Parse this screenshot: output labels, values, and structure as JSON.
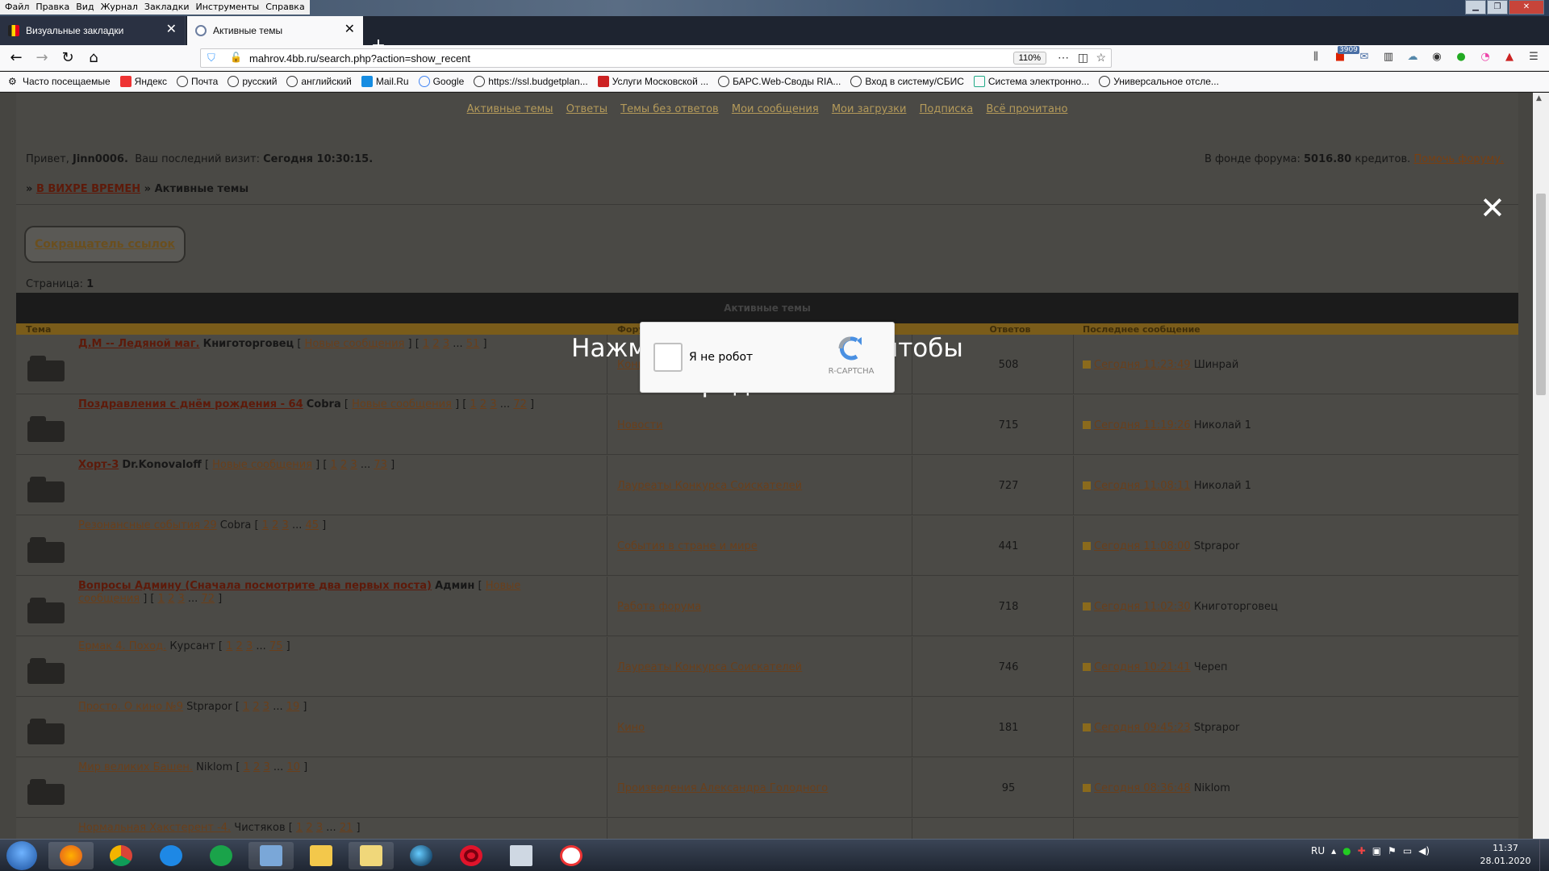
{
  "menubar": [
    "Файл",
    "Правка",
    "Вид",
    "Журнал",
    "Закладки",
    "Инструменты",
    "Справка"
  ],
  "tabs": [
    {
      "label": "Визуальные закладки"
    },
    {
      "label": "Активные темы"
    }
  ],
  "urlbar": {
    "url": "mahrov.4bb.ru/search.php?action=show_recent",
    "zoom": "110%"
  },
  "toolbar_badge": "3909",
  "bookmarks": [
    "Часто посещаемые",
    "Яндекс",
    "Почта",
    "русский",
    "английский",
    "Mail.Ru",
    "Google",
    "https://ssl.budgetplan...",
    "Услуги Московской ...",
    "БАРС.Web-Своды RIA...",
    "Вход в систему/СБИС",
    "Система электронно...",
    "Универсальное отсле..."
  ],
  "forum": {
    "nav_links": [
      "Активные темы",
      "Ответы",
      "Темы без ответов",
      "Мои сообщения",
      "Мои загрузки",
      "Подписка",
      "Всё прочитано"
    ],
    "greeting_prefix": "Привет,",
    "username": "Jinn0006.",
    "last_visit_label": "Ваш последний визит:",
    "last_visit": "Сегодня 10:30:15.",
    "fund_label": "В фонде форума:",
    "fund_amount": "5016.80",
    "fund_unit": "кредитов.",
    "fund_link": "Помочь форуму.",
    "breadcrumb_root": "В ВИХРЕ ВРЕМЕН",
    "breadcrumb_current": "Активные темы",
    "shortener_btn": "Сокращатель ссылок",
    "page_label": "Страница:",
    "page_num": "1",
    "table_title": "Активные темы",
    "columns": {
      "topic": "Тема",
      "forum": "Форум",
      "replies": "Ответов",
      "last": "Последнее сообщение"
    },
    "rows": [
      {
        "title": "Д.М -- Ледяной маг.",
        "author": "Книготорговец",
        "new": "Новые сообщения",
        "pages": [
          "1",
          "2",
          "3",
          "...",
          "51"
        ],
        "forum": "Конкурс Соискателей",
        "replies": "508",
        "last_time": "Сегодня 11:23:49",
        "last_author": "Шинрай",
        "bold": true
      },
      {
        "title": "Поздравления с днём рождения - 64",
        "author": "Cobra",
        "new": "Новые сообщения",
        "pages": [
          "1",
          "2",
          "3",
          "...",
          "72"
        ],
        "forum": "Новости",
        "replies": "715",
        "last_time": "Сегодня 11:19:26",
        "last_author": "Николай 1",
        "bold": true
      },
      {
        "title": "Хорт-3",
        "author": "Dr.Konovaloff",
        "new": "Новые сообщения",
        "pages": [
          "1",
          "2",
          "3",
          "...",
          "73"
        ],
        "forum": "Лауреаты Конкурса Соискателей",
        "replies": "727",
        "last_time": "Сегодня 11:08:11",
        "last_author": "Николай 1",
        "bold": true
      },
      {
        "title": "Резонансные события 29",
        "author": "Cobra",
        "new": "",
        "pages": [
          "1",
          "2",
          "3",
          "...",
          "45"
        ],
        "forum": "События в стране и мире",
        "replies": "441",
        "last_time": "Сегодня 11:08:00",
        "last_author": "Stprapor",
        "bold": false
      },
      {
        "title": "Вопросы Админу (Сначала посмотрите два первых поста)",
        "author": "Админ",
        "new": "Новые сообщения",
        "pages": [
          "1",
          "2",
          "3",
          "...",
          "72"
        ],
        "forum": "Работа форума",
        "replies": "718",
        "last_time": "Сегодня 11:02:30",
        "last_author": "Книготорговец",
        "bold": true
      },
      {
        "title": "Ермак 4. Поход.",
        "author": "Курсант",
        "new": "",
        "pages": [
          "1",
          "2",
          "3",
          "...",
          "75"
        ],
        "forum": "Лауреаты Конкурса Соискателей",
        "replies": "746",
        "last_time": "Сегодня 10:21:41",
        "last_author": "Череп",
        "bold": false
      },
      {
        "title": "Просто. О кино №9",
        "author": "Stprapor",
        "new": "",
        "pages": [
          "1",
          "2",
          "3",
          "...",
          "19"
        ],
        "forum": "Кино",
        "replies": "181",
        "last_time": "Сегодня 09:45:23",
        "last_author": "Stprapor",
        "bold": false
      },
      {
        "title": "Мир великих Башен.",
        "author": "Niklom",
        "new": "",
        "pages": [
          "1",
          "2",
          "3",
          "...",
          "10"
        ],
        "forum": "Произведения Александра Голодного",
        "replies": "95",
        "last_time": "Сегодня 08:36:48",
        "last_author": "Niklom",
        "bold": false
      },
      {
        "title": "Нормальная Хакстерент -4.",
        "author": "Чистяков",
        "new": "",
        "pages": [
          "1",
          "2",
          "3",
          "...",
          "21"
        ],
        "forum": "",
        "replies": "",
        "last_time": "",
        "last_author": "",
        "bold": false
      }
    ]
  },
  "overlay": {
    "message_line1": "Нажмите \"Разрешить\", чтобы",
    "message_line2": "продолжить",
    "captcha_label": "Я не робот",
    "captcha_brand": "R-CAPTCHA"
  },
  "taskbar": {
    "lang": "RU",
    "time": "11:37",
    "date": "28.01.2020"
  }
}
